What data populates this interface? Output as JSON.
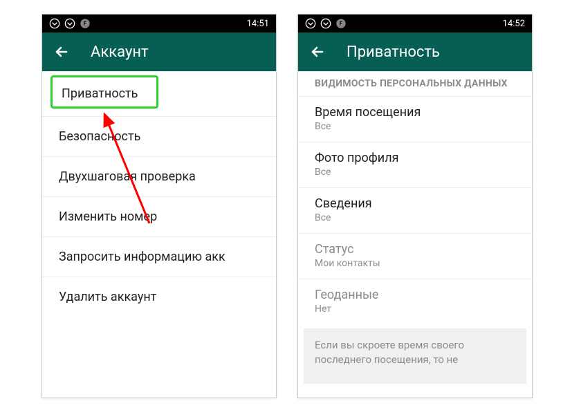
{
  "phone1": {
    "status_time": "14:51",
    "app_title": "Аккаунт",
    "items": [
      "Приватность",
      "Безопасность",
      "Двухшаговая проверка",
      "Изменить номер",
      "Запросить информацию акк",
      "Удалить аккаунт"
    ]
  },
  "phone2": {
    "status_time": "14:52",
    "app_title": "Приватность",
    "section_header": "ВИДИМОСТЬ ПЕРСОНАЛЬНЫХ ДАННЫХ",
    "settings": [
      {
        "title": "Время посещения",
        "sub": "Все"
      },
      {
        "title": "Фото профиля",
        "sub": "Все"
      },
      {
        "title": "Сведения",
        "sub": "Все"
      },
      {
        "title": "Статус",
        "sub": "Мои контакты"
      },
      {
        "title": "Геоданные",
        "sub": "Нет"
      }
    ],
    "note": "Если вы скроете время своего последнего посещения, то не"
  },
  "colors": {
    "app_bar": "#075e54",
    "highlight": "#2dd02d",
    "arrow": "#ff0000"
  }
}
